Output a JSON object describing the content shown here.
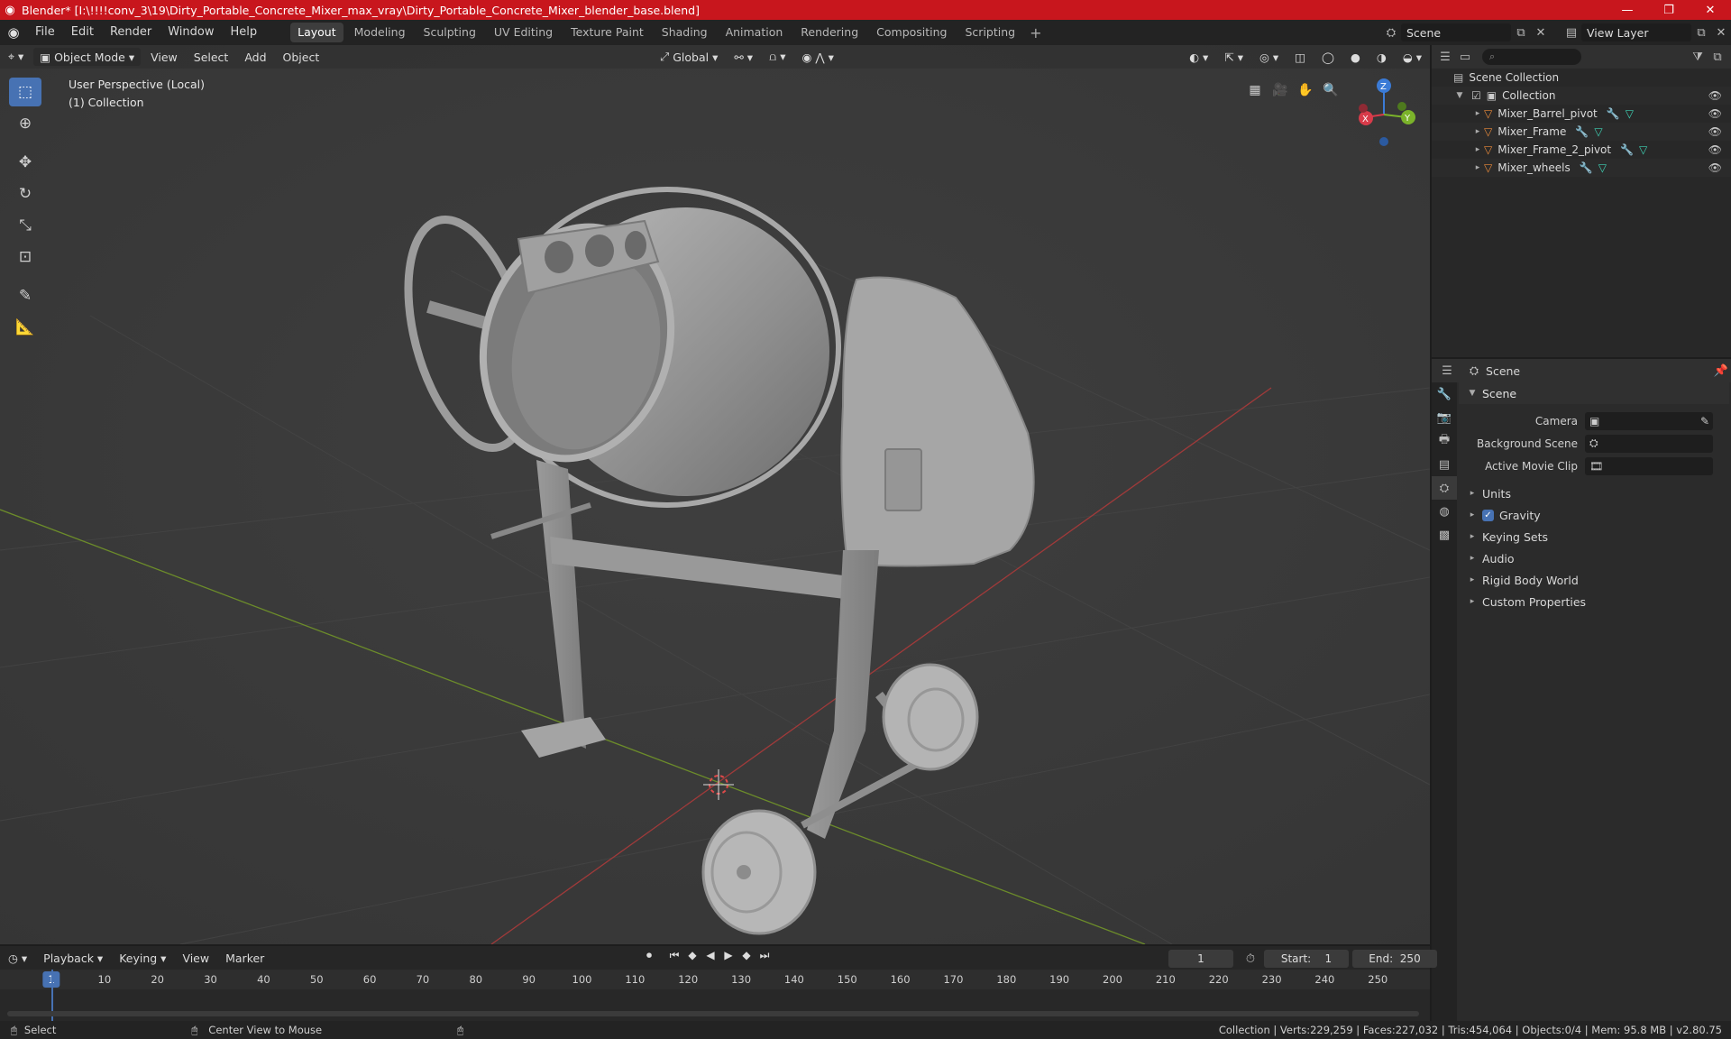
{
  "window": {
    "title": "Blender* [I:\\!!!!conv_3\\19\\Dirty_Portable_Concrete_Mixer_max_vray\\Dirty_Portable_Concrete_Mixer_blender_base.blend]",
    "minimize": "—",
    "maximize": "❐",
    "close": "✕"
  },
  "menu": [
    "File",
    "Edit",
    "Render",
    "Window",
    "Help"
  ],
  "workspaces": [
    "Layout",
    "Modeling",
    "Sculpting",
    "UV Editing",
    "Texture Paint",
    "Shading",
    "Animation",
    "Rendering",
    "Compositing",
    "Scripting"
  ],
  "active_workspace": "Layout",
  "scene_field": "Scene",
  "view_layer_field": "View Layer",
  "viewport": {
    "mode": "Object Mode",
    "menus": [
      "View",
      "Select",
      "Add",
      "Object"
    ],
    "transform_orientation": "Global",
    "info_line1": "User Perspective (Local)",
    "info_line2": "(1) Collection",
    "gizmo_labels": {
      "x": "X",
      "y": "Y",
      "z": "Z"
    }
  },
  "outliner": {
    "root": "Scene Collection",
    "collection": "Collection",
    "objects": [
      "Mixer_Barrel_pivot",
      "Mixer_Frame",
      "Mixer_Frame_2_pivot",
      "Mixer_wheels"
    ]
  },
  "properties": {
    "context": "Scene",
    "panel": "Scene",
    "fields": [
      {
        "label": "Camera"
      },
      {
        "label": "Background Scene"
      },
      {
        "label": "Active Movie Clip"
      }
    ],
    "subpanels": [
      "Units",
      "Gravity",
      "Keying Sets",
      "Audio",
      "Rigid Body World",
      "Custom Properties"
    ]
  },
  "timeline": {
    "menus": [
      "Playback",
      "Keying",
      "View",
      "Marker"
    ],
    "current_frame": "1",
    "start_label": "Start:",
    "start": "1",
    "end_label": "End:",
    "end": "250",
    "ticks": [
      "1",
      "10",
      "20",
      "30",
      "40",
      "50",
      "60",
      "70",
      "80",
      "90",
      "100",
      "110",
      "120",
      "130",
      "140",
      "150",
      "160",
      "170",
      "180",
      "190",
      "200",
      "210",
      "220",
      "230",
      "240",
      "250"
    ]
  },
  "status": {
    "left_action": "Select",
    "middle_action": "Center View to Mouse",
    "stats": "Collection | Verts:229,259 | Faces:227,032 | Tris:454,064 | Objects:0/4 | Mem: 95.8 MB | v2.80.75"
  }
}
